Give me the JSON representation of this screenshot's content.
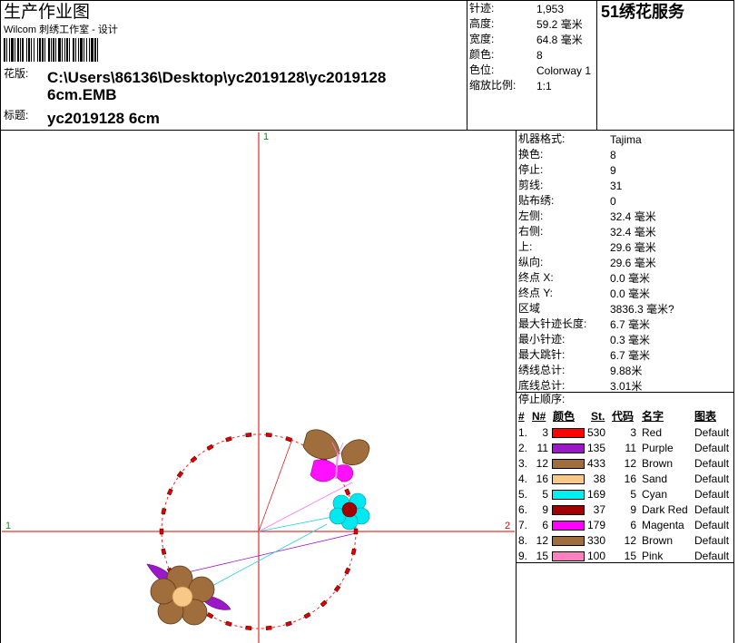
{
  "header": {
    "title": "生产作业图",
    "subtitle": "Wilcom 刺绣工作室 - 设计",
    "file_label": "花版:",
    "file_path_line1": "C:\\Users\\86136\\Desktop\\yc2019128\\yc2019128",
    "file_path_line2": "6cm.EMB",
    "name_label": "标题:",
    "name_value": "yc2019128 6cm",
    "company": "51绣花服务"
  },
  "summary": [
    {
      "label": "针迹:",
      "value": "1,953"
    },
    {
      "label": "高度:",
      "value": "59.2 毫米"
    },
    {
      "label": "宽度:",
      "value": "64.8 毫米"
    },
    {
      "label": "颜色:",
      "value": "8"
    },
    {
      "label": "色位:",
      "value": "Colorway 1"
    },
    {
      "label": "缩放比例:",
      "value": "1:1"
    }
  ],
  "details": [
    {
      "label": "机器格式:",
      "value": "Tajima"
    },
    {
      "label": "换色:",
      "value": "8"
    },
    {
      "label": "停止:",
      "value": "9"
    },
    {
      "label": "剪线:",
      "value": "31"
    },
    {
      "label": "贴布绣:",
      "value": "0"
    },
    {
      "label": "左侧:",
      "value": "32.4 毫米"
    },
    {
      "label": "右侧:",
      "value": "32.4 毫米"
    },
    {
      "label": "上:",
      "value": "29.6 毫米"
    },
    {
      "label": "纵向:",
      "value": "29.6 毫米"
    },
    {
      "label": "终点 X:",
      "value": "0.0 毫米"
    },
    {
      "label": "终点 Y:",
      "value": "0.0 毫米"
    },
    {
      "label": "区域",
      "value": "3836.3 毫米?"
    },
    {
      "label": "最大针迹长度:",
      "value": "6.7 毫米"
    },
    {
      "label": "最小针迹:",
      "value": "0.3 毫米"
    },
    {
      "label": "最大跳针:",
      "value": "6.7 毫米"
    },
    {
      "label": "绣线总计:",
      "value": "9.88米"
    },
    {
      "label": "底线总计:",
      "value": "3.01米"
    }
  ],
  "stop_sequence": {
    "title": "停止顺序:",
    "headers": {
      "num": "#",
      "n": "N#",
      "color": "颜色",
      "st": "St.",
      "code": "代码",
      "name": "名字",
      "chart": "图表"
    },
    "rows": [
      {
        "num": "1.",
        "n": "3",
        "hex": "#ff0000",
        "st": "530",
        "code": "3",
        "name": "Red",
        "chart": "Default"
      },
      {
        "num": "2.",
        "n": "11",
        "hex": "#9b18c8",
        "st": "135",
        "code": "11",
        "name": "Purple",
        "chart": "Default"
      },
      {
        "num": "3.",
        "n": "12",
        "hex": "#a06e3c",
        "st": "433",
        "code": "12",
        "name": "Brown",
        "chart": "Default"
      },
      {
        "num": "4.",
        "n": "16",
        "hex": "#f8c888",
        "st": "38",
        "code": "16",
        "name": "Sand",
        "chart": "Default"
      },
      {
        "num": "5.",
        "n": "5",
        "hex": "#00f0f0",
        "st": "169",
        "code": "5",
        "name": "Cyan",
        "chart": "Default"
      },
      {
        "num": "6.",
        "n": "9",
        "hex": "#a00000",
        "st": "37",
        "code": "9",
        "name": "Dark Red",
        "chart": "Default"
      },
      {
        "num": "7.",
        "n": "6",
        "hex": "#ff00ff",
        "st": "179",
        "code": "6",
        "name": "Magenta",
        "chart": "Default"
      },
      {
        "num": "8.",
        "n": "12",
        "hex": "#a06e3c",
        "st": "330",
        "code": "12",
        "name": "Brown",
        "chart": "Default"
      },
      {
        "num": "9.",
        "n": "15",
        "hex": "#ff80c0",
        "st": "100",
        "code": "15",
        "name": "Pink",
        "chart": "Default"
      }
    ]
  },
  "axes": {
    "top_label": "1",
    "left_label": "1",
    "right_label": "2"
  }
}
